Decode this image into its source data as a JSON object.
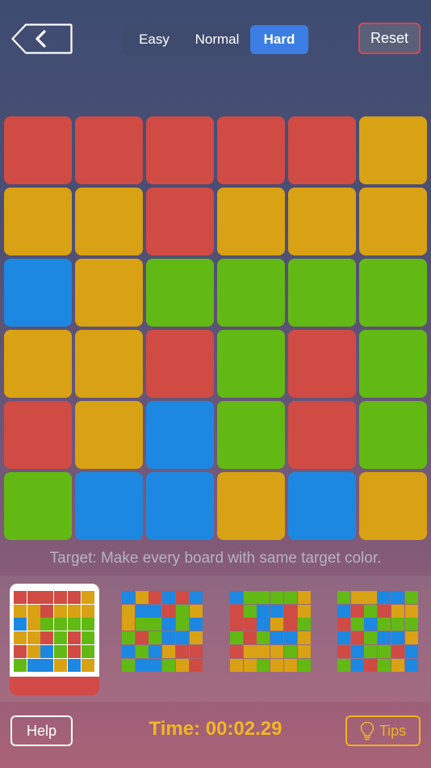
{
  "colors": {
    "R": "#d04b44",
    "Y": "#d9a114",
    "G": "#62b913",
    "B": "#1d88e1"
  },
  "header": {
    "back_icon": "chevron-left-icon",
    "difficulty": [
      "Easy",
      "Normal",
      "Hard"
    ],
    "selected_difficulty": "Hard",
    "reset_label": "Reset"
  },
  "board": [
    [
      "R",
      "R",
      "R",
      "R",
      "R",
      "Y"
    ],
    [
      "Y",
      "Y",
      "R",
      "Y",
      "Y",
      "Y"
    ],
    [
      "B",
      "Y",
      "G",
      "G",
      "G",
      "G"
    ],
    [
      "Y",
      "Y",
      "R",
      "G",
      "R",
      "G"
    ],
    [
      "R",
      "Y",
      "B",
      "G",
      "R",
      "G"
    ],
    [
      "G",
      "B",
      "B",
      "Y",
      "B",
      "Y"
    ]
  ],
  "target_text": "Target: Make every board with same target color.",
  "thumbnails": [
    [
      [
        "R",
        "R",
        "R",
        "R",
        "R",
        "Y"
      ],
      [
        "Y",
        "Y",
        "R",
        "Y",
        "Y",
        "Y"
      ],
      [
        "B",
        "Y",
        "G",
        "G",
        "G",
        "G"
      ],
      [
        "Y",
        "Y",
        "R",
        "G",
        "R",
        "G"
      ],
      [
        "R",
        "Y",
        "B",
        "G",
        "R",
        "G"
      ],
      [
        "G",
        "B",
        "B",
        "Y",
        "B",
        "Y"
      ]
    ],
    [
      [
        "B",
        "Y",
        "R",
        "B",
        "R",
        "B"
      ],
      [
        "Y",
        "B",
        "B",
        "R",
        "G",
        "Y"
      ],
      [
        "Y",
        "G",
        "G",
        "B",
        "G",
        "B"
      ],
      [
        "G",
        "R",
        "G",
        "B",
        "B",
        "Y"
      ],
      [
        "B",
        "G",
        "B",
        "Y",
        "R",
        "R"
      ],
      [
        "G",
        "B",
        "B",
        "G",
        "Y",
        "R"
      ]
    ],
    [
      [
        "B",
        "G",
        "G",
        "G",
        "G",
        "Y"
      ],
      [
        "R",
        "G",
        "B",
        "B",
        "R",
        "Y"
      ],
      [
        "R",
        "R",
        "B",
        "Y",
        "R",
        "G"
      ],
      [
        "G",
        "R",
        "G",
        "B",
        "B",
        "Y"
      ],
      [
        "R",
        "Y",
        "Y",
        "Y",
        "G",
        "Y"
      ],
      [
        "Y",
        "Y",
        "G",
        "Y",
        "Y",
        "G"
      ]
    ],
    [
      [
        "G",
        "Y",
        "Y",
        "B",
        "B",
        "G"
      ],
      [
        "B",
        "R",
        "G",
        "R",
        "Y",
        "Y"
      ],
      [
        "R",
        "G",
        "B",
        "G",
        "G",
        "G"
      ],
      [
        "B",
        "R",
        "G",
        "B",
        "B",
        "Y"
      ],
      [
        "R",
        "B",
        "G",
        "G",
        "R",
        "B"
      ],
      [
        "G",
        "B",
        "R",
        "G",
        "Y",
        "B"
      ]
    ]
  ],
  "selected_thumbnail": 0,
  "footer": {
    "help_label": "Help",
    "timer": "Time: 00:02.29",
    "tips_label": "Tips",
    "tips_icon": "lightbulb-icon"
  }
}
